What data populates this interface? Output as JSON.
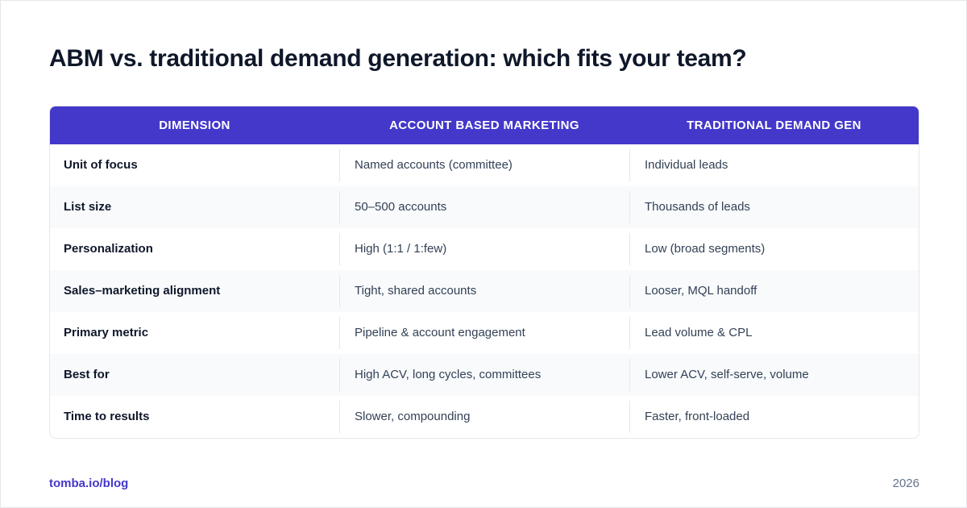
{
  "title": "ABM vs. traditional demand generation: which fits your team?",
  "table": {
    "headers": [
      "DIMENSION",
      "ACCOUNT BASED MARKETING",
      "TRADITIONAL DEMAND GEN"
    ],
    "rows": [
      [
        "Unit of focus",
        "Named accounts (committee)",
        "Individual leads"
      ],
      [
        "List size",
        "50–500 accounts",
        "Thousands of leads"
      ],
      [
        "Personalization",
        "High (1:1 / 1:few)",
        "Low (broad segments)"
      ],
      [
        "Sales–marketing alignment",
        "Tight, shared accounts",
        "Looser, MQL handoff"
      ],
      [
        "Primary metric",
        "Pipeline & account engagement",
        "Lead volume & CPL"
      ],
      [
        "Best for",
        "High ACV, long cycles, committees",
        "Lower ACV, self-serve, volume"
      ],
      [
        "Time to results",
        "Slower, compounding",
        "Faster, front-loaded"
      ]
    ]
  },
  "footer": {
    "link": "tomba.io/blog",
    "year": "2026"
  },
  "colors": {
    "header_bg": "#4338ca",
    "accent": "#4338ca",
    "alt_row_bg": "#f8fafc"
  }
}
